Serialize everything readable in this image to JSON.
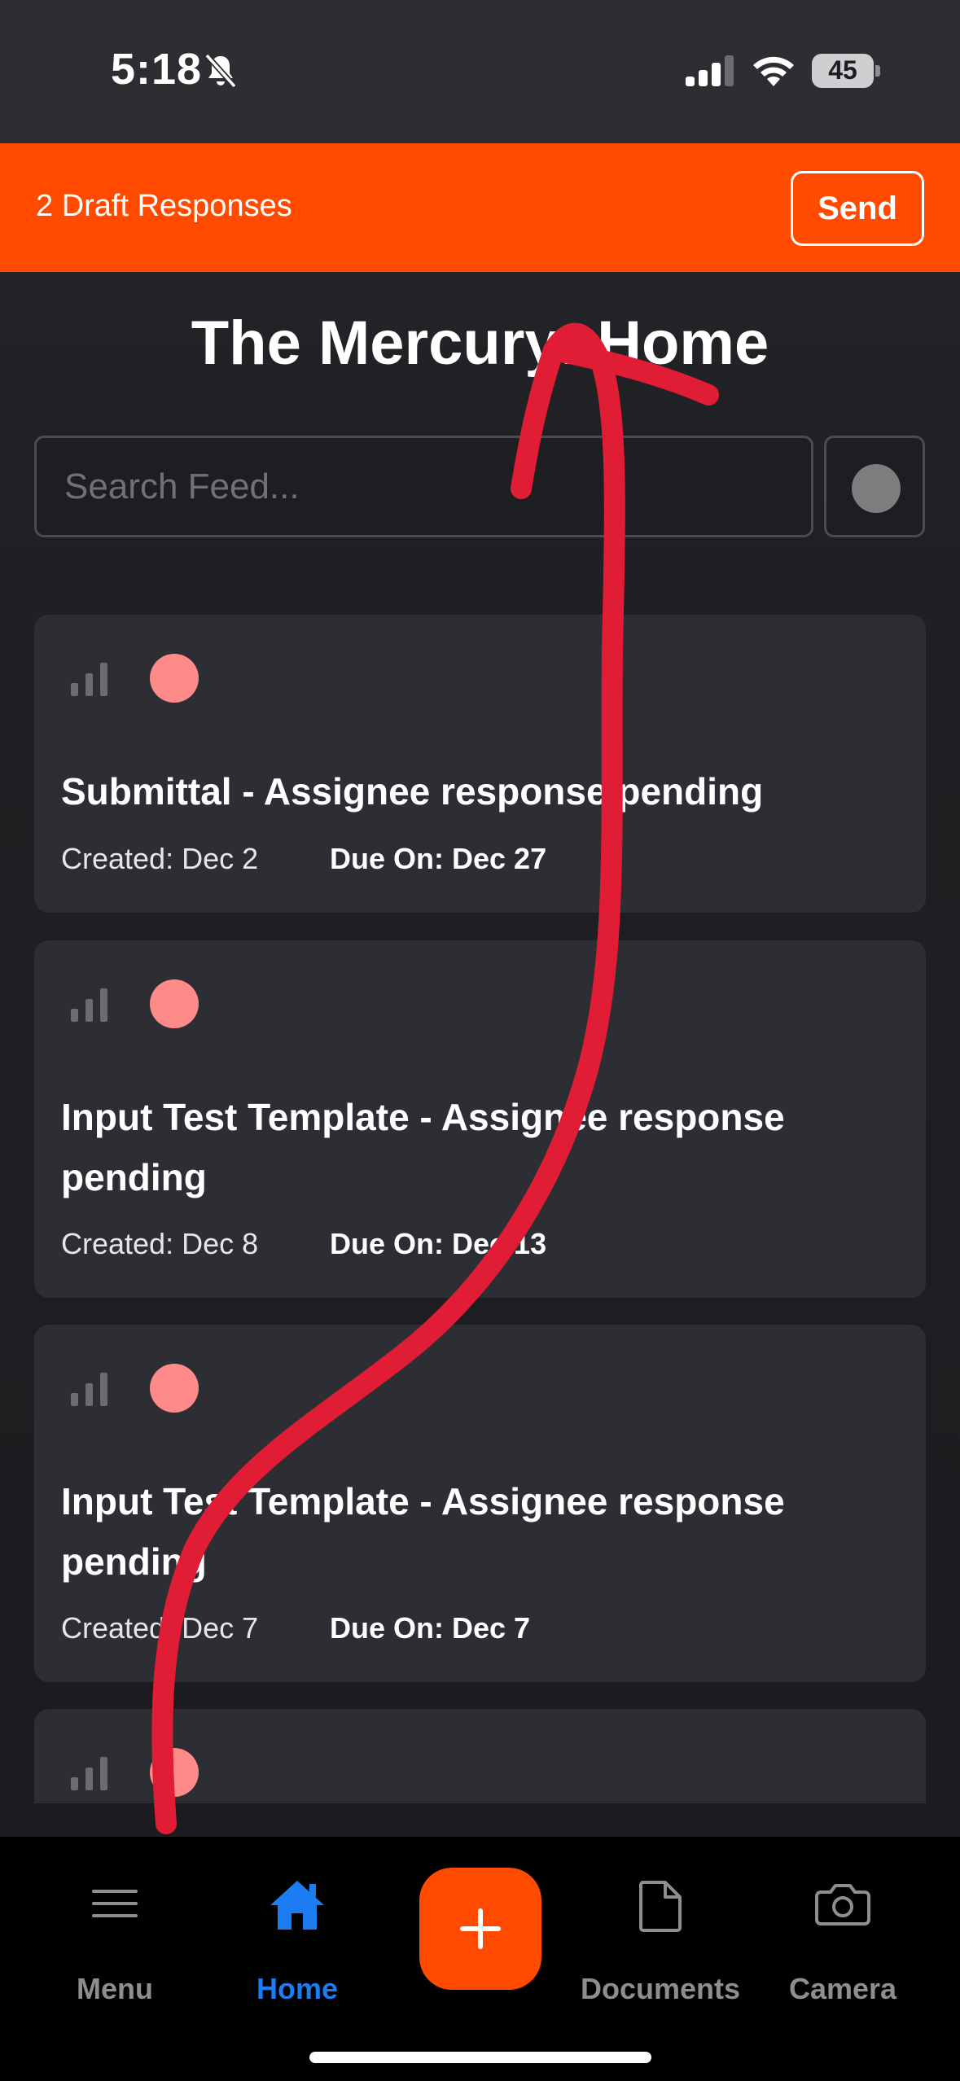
{
  "status_bar": {
    "time": "5:18",
    "battery": "45",
    "icons": [
      "bell-slash-icon",
      "cellular-signal-icon",
      "wifi-icon",
      "battery-icon"
    ]
  },
  "draft_banner": {
    "text": "2 Draft Responses",
    "send_label": "Send",
    "color": "#ff4a00"
  },
  "page": {
    "title": "The Mercury: Home"
  },
  "search": {
    "placeholder": "Search Feed..."
  },
  "feed": {
    "cards": [
      {
        "title": "Submittal - Assignee response pending",
        "created": "Created: Dec 2",
        "due": "Due On: Dec 27"
      },
      {
        "title": "Input Test Template - Assignee response pending",
        "created": "Created: Dec 8",
        "due": "Due On: Dec 13"
      },
      {
        "title": "Input Test Template - Assignee response pending",
        "created": "Created: Dec 7",
        "due": "Due On: Dec 7"
      },
      {
        "title": "",
        "created": "",
        "due": ""
      }
    ],
    "status_dot_color": "#ff8a8a"
  },
  "bottom_nav": {
    "items": [
      {
        "label": "Menu",
        "icon": "hamburger-menu-icon"
      },
      {
        "label": "Home",
        "icon": "home-icon",
        "active": true
      },
      {
        "label": "Documents",
        "icon": "document-icon"
      },
      {
        "label": "Camera",
        "icon": "camera-icon"
      }
    ],
    "add_icon": "plus-icon",
    "active_color": "#1c7cf2"
  },
  "annotation": {
    "type": "red hand-drawn arrow pointing up",
    "color": "#e11d35"
  }
}
